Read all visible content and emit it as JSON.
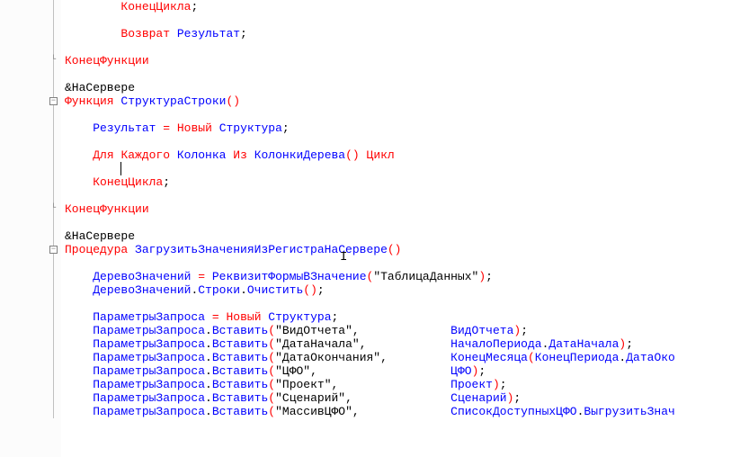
{
  "lines": [
    {
      "indent": 2,
      "tokens": [
        {
          "t": "КонецЦикла",
          "c": "kw-red"
        },
        {
          "t": ";",
          "c": "semi"
        }
      ]
    },
    {
      "indent": 2,
      "tokens": []
    },
    {
      "indent": 2,
      "tokens": [
        {
          "t": "Возврат",
          "c": "kw-red"
        },
        {
          "t": " Результат",
          "c": "var"
        },
        {
          "t": ";",
          "c": "semi"
        }
      ]
    },
    {
      "indent": 2,
      "tokens": []
    },
    {
      "indent": 0,
      "fold": "end",
      "tokens": [
        {
          "t": "КонецФункции",
          "c": "kw-red"
        }
      ]
    },
    {
      "indent": 0,
      "tokens": []
    },
    {
      "indent": 0,
      "tokens": [
        {
          "t": "&НаСервере",
          "c": "black"
        }
      ]
    },
    {
      "indent": 0,
      "fold": "minus",
      "tokens": [
        {
          "t": "Функция",
          "c": "kw-red"
        },
        {
          "t": " СтруктураСтроки",
          "c": "var"
        },
        {
          "t": "()",
          "c": "paren"
        }
      ]
    },
    {
      "indent": 0,
      "tokens": []
    },
    {
      "indent": 1,
      "tokens": [
        {
          "t": "Результат",
          "c": "var"
        },
        {
          "t": " ",
          "c": "black"
        },
        {
          "t": "=",
          "c": "eq"
        },
        {
          "t": " ",
          "c": "black"
        },
        {
          "t": "Новый",
          "c": "kw-red"
        },
        {
          "t": " Структура",
          "c": "var"
        },
        {
          "t": ";",
          "c": "semi"
        }
      ]
    },
    {
      "indent": 1,
      "tokens": []
    },
    {
      "indent": 1,
      "tokens": [
        {
          "t": "Для",
          "c": "kw-red"
        },
        {
          "t": " ",
          "c": "black"
        },
        {
          "t": "Каждого",
          "c": "kw-red"
        },
        {
          "t": " Колонка",
          "c": "var"
        },
        {
          "t": " ",
          "c": "black"
        },
        {
          "t": "Из",
          "c": "kw-red"
        },
        {
          "t": " КолонкиДерева",
          "c": "var"
        },
        {
          "t": "()",
          "c": "paren"
        },
        {
          "t": " ",
          "c": "black"
        },
        {
          "t": "Цикл",
          "c": "kw-red"
        }
      ]
    },
    {
      "indent": 2,
      "caret": true,
      "tokens": []
    },
    {
      "indent": 1,
      "tokens": [
        {
          "t": "КонецЦикла",
          "c": "kw-red"
        },
        {
          "t": ";",
          "c": "semi"
        }
      ]
    },
    {
      "indent": 1,
      "tokens": []
    },
    {
      "indent": 0,
      "fold": "end",
      "tokens": [
        {
          "t": "КонецФункции",
          "c": "kw-red"
        }
      ]
    },
    {
      "indent": 0,
      "tokens": []
    },
    {
      "indent": 0,
      "tokens": [
        {
          "t": "&НаСервере",
          "c": "black"
        }
      ]
    },
    {
      "indent": 0,
      "fold": "minus",
      "tokens": [
        {
          "t": "Процедура",
          "c": "kw-red"
        },
        {
          "t": " ЗагрузитьЗначенияИзРегистраНаСервере",
          "c": "var"
        },
        {
          "t": "()",
          "c": "paren"
        }
      ]
    },
    {
      "indent": 0,
      "tokens": []
    },
    {
      "indent": 1,
      "tokens": [
        {
          "t": "ДеревоЗначений",
          "c": "var"
        },
        {
          "t": " ",
          "c": "black"
        },
        {
          "t": "=",
          "c": "eq"
        },
        {
          "t": " РеквизитФормыВЗначение",
          "c": "var"
        },
        {
          "t": "(",
          "c": "paren"
        },
        {
          "t": "\"ТаблицаДанных\"",
          "c": "str"
        },
        {
          "t": ")",
          "c": "paren"
        },
        {
          "t": ";",
          "c": "semi"
        }
      ]
    },
    {
      "indent": 1,
      "tokens": [
        {
          "t": "ДеревоЗначений",
          "c": "var"
        },
        {
          "t": ".",
          "c": "black"
        },
        {
          "t": "Строки",
          "c": "var"
        },
        {
          "t": ".",
          "c": "black"
        },
        {
          "t": "Очистить",
          "c": "var"
        },
        {
          "t": "()",
          "c": "paren"
        },
        {
          "t": ";",
          "c": "semi"
        }
      ]
    },
    {
      "indent": 1,
      "tokens": []
    },
    {
      "indent": 1,
      "tokens": [
        {
          "t": "ПараметрыЗапроса",
          "c": "var"
        },
        {
          "t": " ",
          "c": "black"
        },
        {
          "t": "=",
          "c": "eq"
        },
        {
          "t": " ",
          "c": "black"
        },
        {
          "t": "Новый",
          "c": "kw-red"
        },
        {
          "t": " Структура",
          "c": "var"
        },
        {
          "t": ";",
          "c": "semi"
        }
      ]
    },
    {
      "indent": 1,
      "pad": true,
      "tokens": [
        {
          "t": "ПараметрыЗапроса",
          "c": "var"
        },
        {
          "t": ".",
          "c": "black"
        },
        {
          "t": "Вставить",
          "c": "var"
        },
        {
          "t": "(",
          "c": "paren"
        },
        {
          "t": "\"ВидОтчета\"",
          "c": "str"
        },
        {
          "t": ",",
          "c": "comma"
        }
      ],
      "right": [
        {
          "t": "ВидОтчета",
          "c": "var"
        },
        {
          "t": ")",
          "c": "paren"
        },
        {
          "t": ";",
          "c": "semi"
        }
      ]
    },
    {
      "indent": 1,
      "pad": true,
      "tokens": [
        {
          "t": "ПараметрыЗапроса",
          "c": "var"
        },
        {
          "t": ".",
          "c": "black"
        },
        {
          "t": "Вставить",
          "c": "var"
        },
        {
          "t": "(",
          "c": "paren"
        },
        {
          "t": "\"ДатаНачала\"",
          "c": "str"
        },
        {
          "t": ",",
          "c": "comma"
        }
      ],
      "right": [
        {
          "t": "НачалоПериода",
          "c": "var"
        },
        {
          "t": ".",
          "c": "black"
        },
        {
          "t": "ДатаНачала",
          "c": "var"
        },
        {
          "t": ")",
          "c": "paren"
        },
        {
          "t": ";",
          "c": "semi"
        }
      ]
    },
    {
      "indent": 1,
      "pad": true,
      "tokens": [
        {
          "t": "ПараметрыЗапроса",
          "c": "var"
        },
        {
          "t": ".",
          "c": "black"
        },
        {
          "t": "Вставить",
          "c": "var"
        },
        {
          "t": "(",
          "c": "paren"
        },
        {
          "t": "\"ДатаОкончания\"",
          "c": "str"
        },
        {
          "t": ",",
          "c": "comma"
        }
      ],
      "right": [
        {
          "t": "КонецМесяца",
          "c": "var"
        },
        {
          "t": "(",
          "c": "paren"
        },
        {
          "t": "КонецПериода",
          "c": "var"
        },
        {
          "t": ".",
          "c": "black"
        },
        {
          "t": "ДатаОко",
          "c": "var"
        }
      ]
    },
    {
      "indent": 1,
      "pad": true,
      "tokens": [
        {
          "t": "ПараметрыЗапроса",
          "c": "var"
        },
        {
          "t": ".",
          "c": "black"
        },
        {
          "t": "Вставить",
          "c": "var"
        },
        {
          "t": "(",
          "c": "paren"
        },
        {
          "t": "\"ЦФО\"",
          "c": "str"
        },
        {
          "t": ",",
          "c": "comma"
        }
      ],
      "right": [
        {
          "t": "ЦФО",
          "c": "var"
        },
        {
          "t": ")",
          "c": "paren"
        },
        {
          "t": ";",
          "c": "semi"
        }
      ]
    },
    {
      "indent": 1,
      "pad": true,
      "tokens": [
        {
          "t": "ПараметрыЗапроса",
          "c": "var"
        },
        {
          "t": ".",
          "c": "black"
        },
        {
          "t": "Вставить",
          "c": "var"
        },
        {
          "t": "(",
          "c": "paren"
        },
        {
          "t": "\"Проект\"",
          "c": "str"
        },
        {
          "t": ",",
          "c": "comma"
        }
      ],
      "right": [
        {
          "t": "Проект",
          "c": "var"
        },
        {
          "t": ")",
          "c": "paren"
        },
        {
          "t": ";",
          "c": "semi"
        }
      ]
    },
    {
      "indent": 1,
      "pad": true,
      "tokens": [
        {
          "t": "ПараметрыЗапроса",
          "c": "var"
        },
        {
          "t": ".",
          "c": "black"
        },
        {
          "t": "Вставить",
          "c": "var"
        },
        {
          "t": "(",
          "c": "paren"
        },
        {
          "t": "\"Сценарий\"",
          "c": "str"
        },
        {
          "t": ",",
          "c": "comma"
        }
      ],
      "right": [
        {
          "t": "Сценарий",
          "c": "var"
        },
        {
          "t": ")",
          "c": "paren"
        },
        {
          "t": ";",
          "c": "semi"
        }
      ]
    },
    {
      "indent": 1,
      "pad": true,
      "tokens": [
        {
          "t": "ПараметрыЗапроса",
          "c": "var"
        },
        {
          "t": ".",
          "c": "black"
        },
        {
          "t": "Вставить",
          "c": "var"
        },
        {
          "t": "(",
          "c": "paren"
        },
        {
          "t": "\"МассивЦФО\"",
          "c": "str"
        },
        {
          "t": ",",
          "c": "comma"
        }
      ],
      "right": [
        {
          "t": "СписокДоступныхЦФО",
          "c": "var"
        },
        {
          "t": ".",
          "c": "black"
        },
        {
          "t": "ВыгрузитьЗнач",
          "c": "var"
        }
      ]
    }
  ],
  "leftColWidth": 55,
  "indentUnit": "    "
}
